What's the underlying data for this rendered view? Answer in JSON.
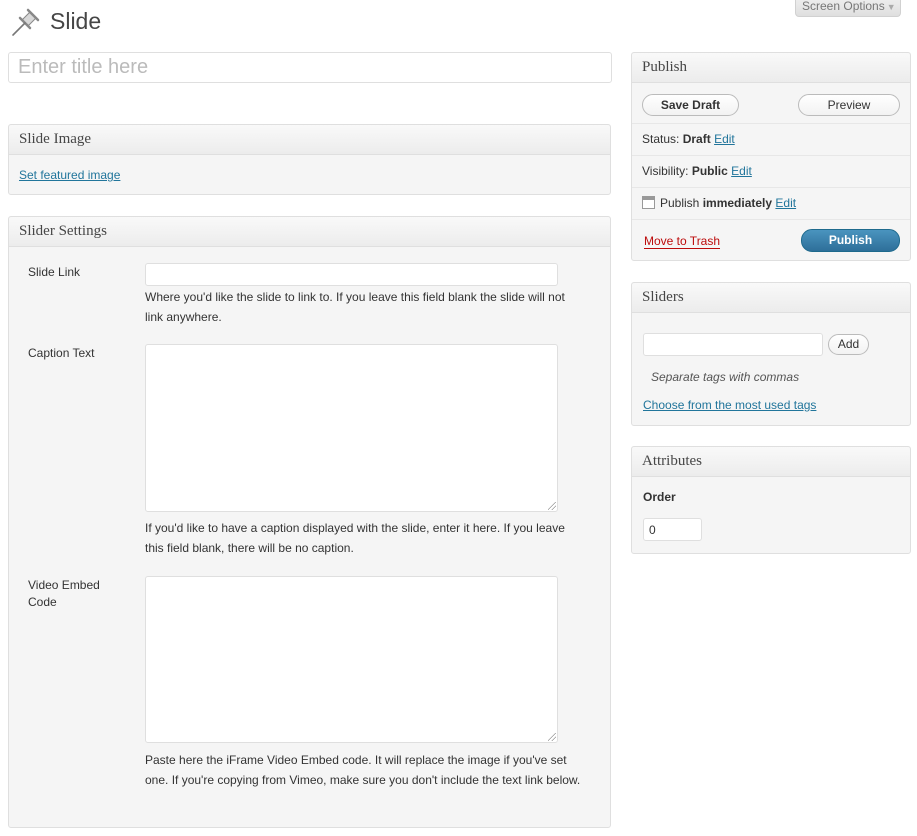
{
  "header": {
    "title": "Slide",
    "screen_options": "Screen Options"
  },
  "title_input": {
    "placeholder": "Enter title here",
    "value": ""
  },
  "slide_image": {
    "heading": "Slide Image",
    "link": "Set featured image"
  },
  "slider_settings": {
    "heading": "Slider Settings",
    "slide_link": {
      "label": "Slide Link",
      "value": "",
      "description": "Where you'd like the slide to link to. If you leave this field blank the slide will not link anywhere."
    },
    "caption_text": {
      "label": "Caption Text",
      "value": "",
      "description": "If you'd like to have a caption displayed with the slide, enter it here. If you leave this field blank, there will be no caption."
    },
    "video_embed": {
      "label": "Video Embed Code",
      "value": "",
      "description": "Paste here the iFrame Video Embed code. It will replace the image if you've set one. If you're copying from Vimeo, make sure you don't include the text link below."
    }
  },
  "publish": {
    "heading": "Publish",
    "save_draft": "Save Draft",
    "preview": "Preview",
    "status_label": "Status:",
    "status_value": "Draft",
    "visibility_label": "Visibility:",
    "visibility_value": "Public",
    "schedule_label": "Publish",
    "schedule_value": "immediately",
    "edit": "Edit",
    "move_to_trash": "Move to Trash",
    "publish_button": "Publish"
  },
  "sliders": {
    "heading": "Sliders",
    "input_value": "",
    "add_button": "Add",
    "hint": "Separate tags with commas",
    "choose_link": "Choose from the most used tags"
  },
  "attributes": {
    "heading": "Attributes",
    "order_label": "Order",
    "order_value": "0"
  }
}
